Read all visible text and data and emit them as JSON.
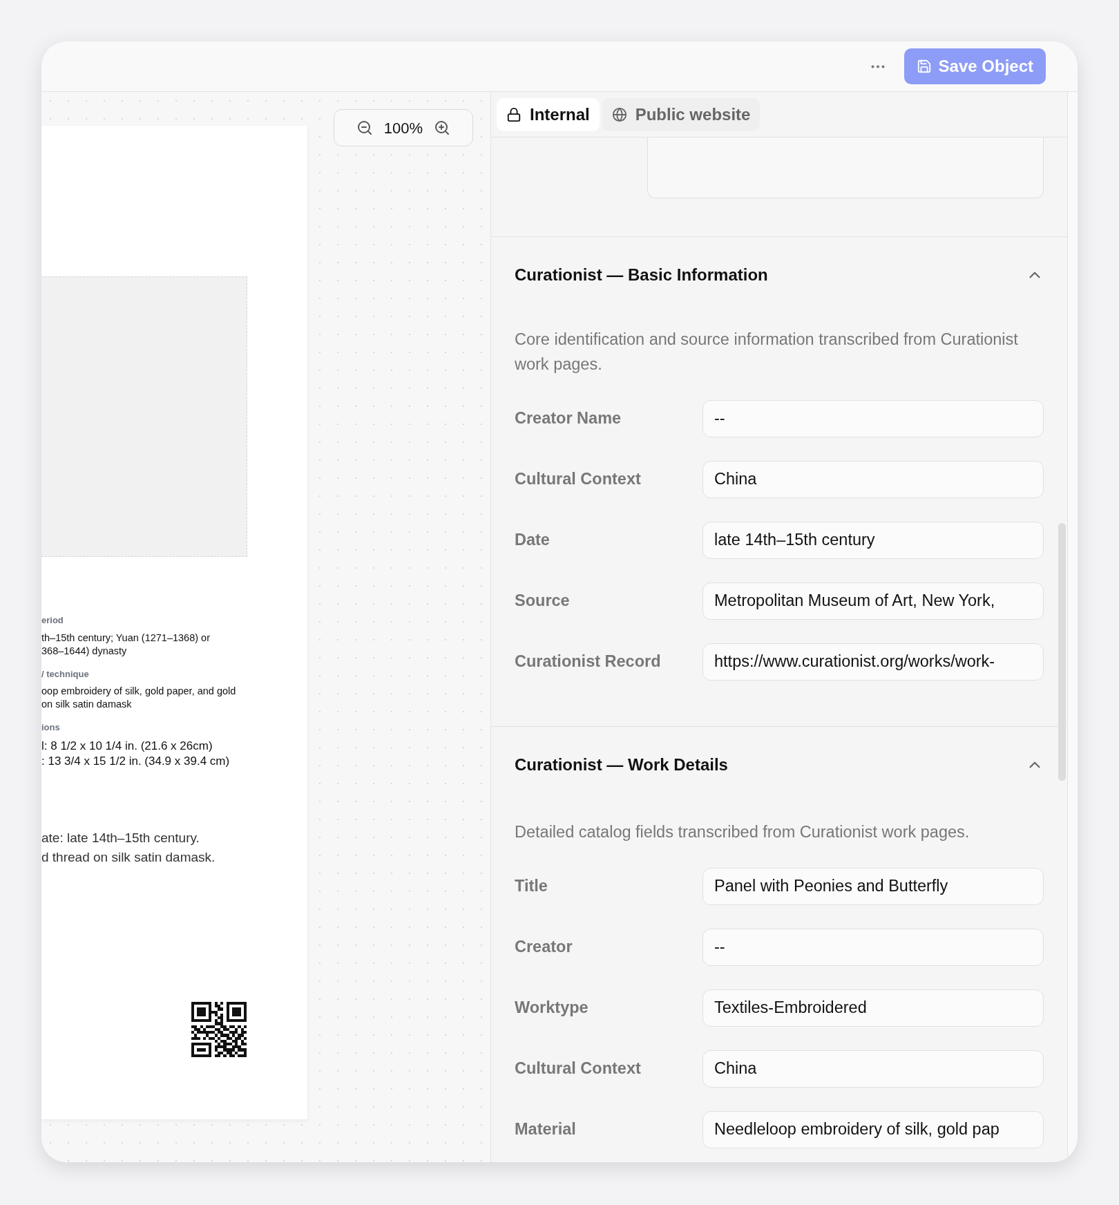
{
  "toolbar": {
    "save_button": "Save Object"
  },
  "canvas": {
    "zoom": "100%",
    "label_sheet": {
      "fields": [
        {
          "label": "eriod",
          "lines": [
            "th–15th century; Yuan (1271–1368) or",
            "368–1644) dynasty"
          ]
        },
        {
          "label": "/ technique",
          "lines": [
            "oop embroidery of silk, gold paper, and gold",
            "on silk satin damask"
          ]
        },
        {
          "label": "ions",
          "lines": [
            "l: 8 1/2 x 10 1/4 in. (21.6 x 26cm)",
            ": 13 3/4 x 15 1/2 in. (34.9 x 39.4 cm)"
          ]
        }
      ],
      "caption": [
        "ate: late 14th–15th century.",
        "d thread on silk satin damask."
      ]
    }
  },
  "tabs": [
    {
      "label": "Internal",
      "selected": true
    },
    {
      "label": "Public website",
      "selected": false
    }
  ],
  "sections": [
    {
      "title": "Curationist — Basic Information",
      "expanded": true,
      "description": "Core identification and source information transcribed from Curationist work pages.",
      "fields": [
        {
          "label": "Creator Name",
          "value": "--"
        },
        {
          "label": "Cultural Context",
          "value": "China"
        },
        {
          "label": "Date",
          "value": "late 14th–15th century"
        },
        {
          "label": "Source",
          "value": "Metropolitan Museum of Art, New York,"
        },
        {
          "label": "Curationist Record",
          "value": "https://www.curationist.org/works/work-"
        }
      ]
    },
    {
      "title": "Curationist — Work Details",
      "expanded": true,
      "description": "Detailed catalog fields transcribed from Curationist work pages.",
      "fields": [
        {
          "label": "Title",
          "value": "Panel with Peonies and Butterfly"
        },
        {
          "label": "Creator",
          "value": "--"
        },
        {
          "label": "Worktype",
          "value": "Textiles-Embroidered"
        },
        {
          "label": "Cultural Context",
          "value": "China"
        },
        {
          "label": "Material",
          "value": "Needleloop embroidery of silk, gold pap"
        }
      ]
    }
  ]
}
